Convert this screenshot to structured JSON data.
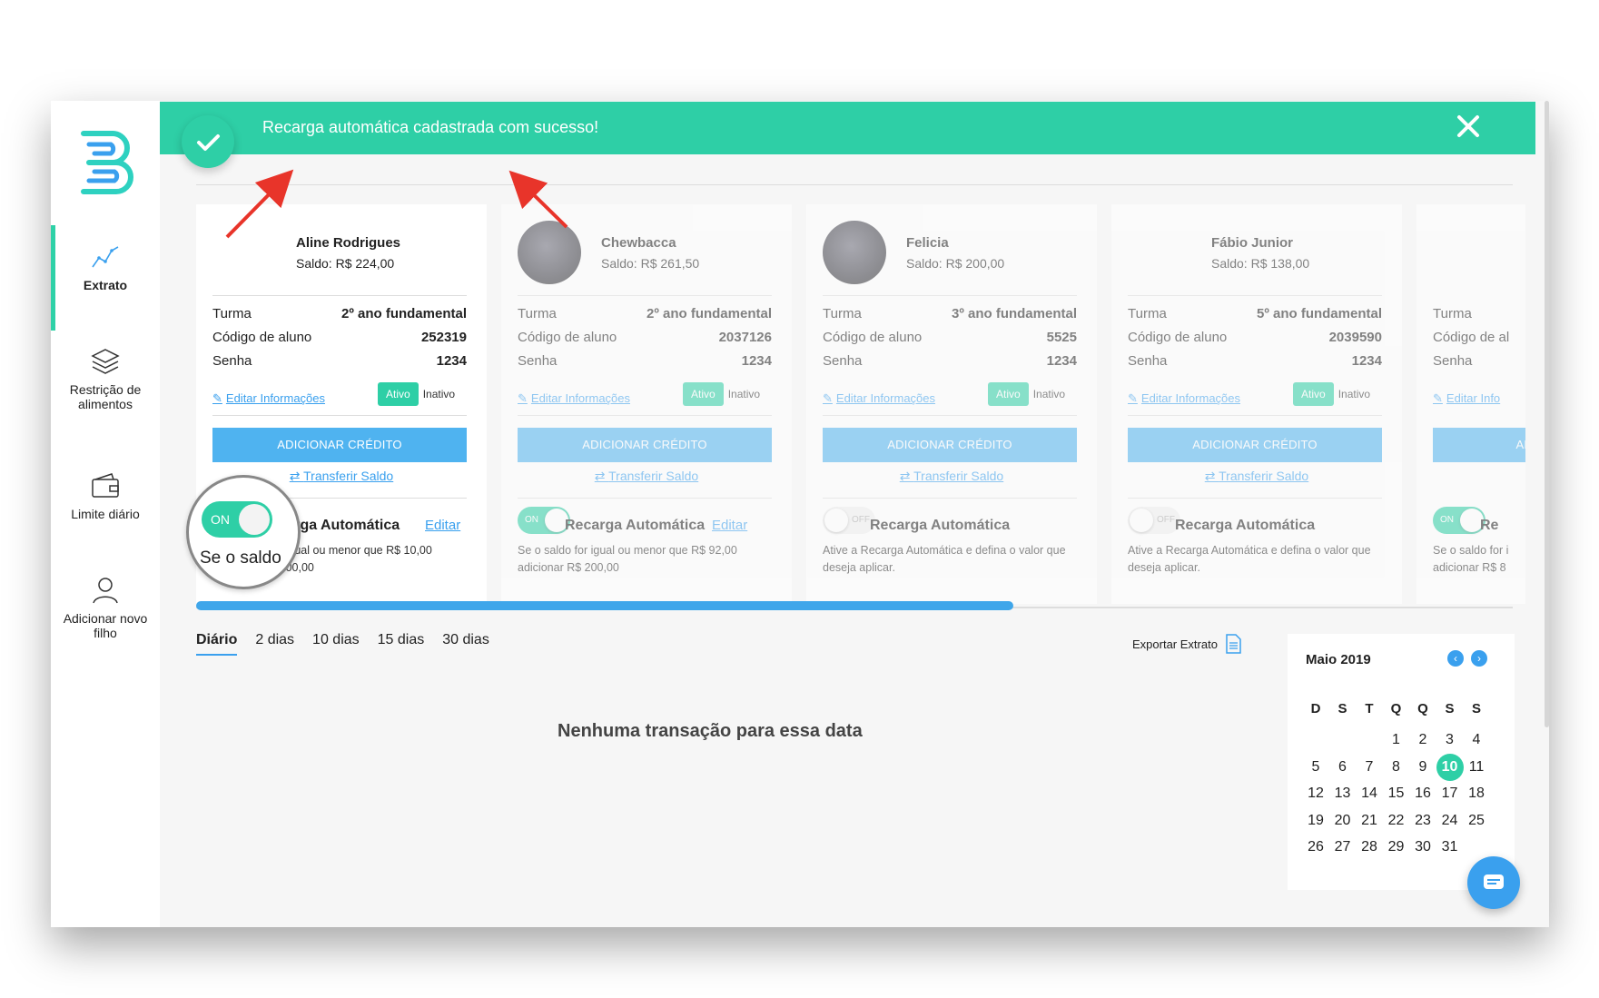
{
  "banner": {
    "message": "Recarga automática cadastrada com sucesso!"
  },
  "sidebar": {
    "items": [
      {
        "label": "Extrato",
        "icon": "chart-line-icon"
      },
      {
        "label": "Restrição de alimentos",
        "icon": "layers-icon"
      },
      {
        "label": "Limite diário",
        "icon": "wallet-icon"
      },
      {
        "label": "Adicionar novo filho",
        "icon": "user-icon"
      }
    ]
  },
  "labels": {
    "turma": "Turma",
    "codigo": "Código de aluno",
    "senha": "Senha",
    "editar_info": "Editar Informações",
    "ativo": "Ativo",
    "inativo": "Inativo",
    "adicionar_credito": "ADICIONAR CRÉDITO",
    "transferir_saldo": "Transferir Saldo",
    "recarga_automatica": "Recarga Automática",
    "editar": "Editar"
  },
  "cards": [
    {
      "name": "Aline Rodrigues",
      "saldo": "Saldo: R$ 224,00",
      "turma": "2º ano fundamental",
      "codigo": "252319",
      "senha": "1234",
      "auto": "on",
      "toggle_label": "ON",
      "desc": "Se o saldo for igual ou menor que R$ 10,00 adicionar R$ 100,00"
    },
    {
      "name": "Chewbacca",
      "saldo": "Saldo: R$ 261,50",
      "turma": "2º ano fundamental",
      "codigo": "2037126",
      "senha": "1234",
      "auto": "on",
      "toggle_label": "ON",
      "desc": "Se o saldo for igual ou menor que R$ 92,00 adicionar R$ 200,00"
    },
    {
      "name": "Felicia",
      "saldo": "Saldo: R$ 200,00",
      "turma": "3º ano fundamental",
      "codigo": "5525",
      "senha": "1234",
      "auto": "off",
      "toggle_label": "OFF",
      "desc": "Ative a Recarga Automática e defina o valor que deseja aplicar."
    },
    {
      "name": "Fábio Junior",
      "saldo": "Saldo: R$ 138,00",
      "turma": "5º ano fundamental",
      "codigo": "2039590",
      "senha": "1234",
      "auto": "off",
      "toggle_label": "OFF",
      "desc": "Ative a Recarga Automática e defina o valor que deseja aplicar."
    }
  ],
  "partial_card": {
    "turma": "Turma",
    "codigo": "Código de al",
    "senha": "Senha",
    "editar": "Editar Info",
    "btn": "AD",
    "auto_title": "Re",
    "desc_line1": "Se o saldo for i",
    "desc_line2": "adicionar R$ 8"
  },
  "magnifier": {
    "toggle_label": "ON",
    "text_line": "Se o saldo",
    "title_fragment": "carga Automática"
  },
  "tabs": [
    "Diário",
    "2 dias",
    "10 dias",
    "15 dias",
    "30 dias"
  ],
  "export_label": "Exportar Extrato",
  "empty_message": "Nenhuma transação para essa data",
  "calendar": {
    "title": "Maio 2019",
    "weekdays": [
      "D",
      "S",
      "T",
      "Q",
      "Q",
      "S",
      "S"
    ],
    "first_weekday_index": 3,
    "days_in_month": 31,
    "selected_day": 10
  },
  "colors": {
    "accent": "#2ecfa6",
    "blue": "#3aa0ee"
  }
}
